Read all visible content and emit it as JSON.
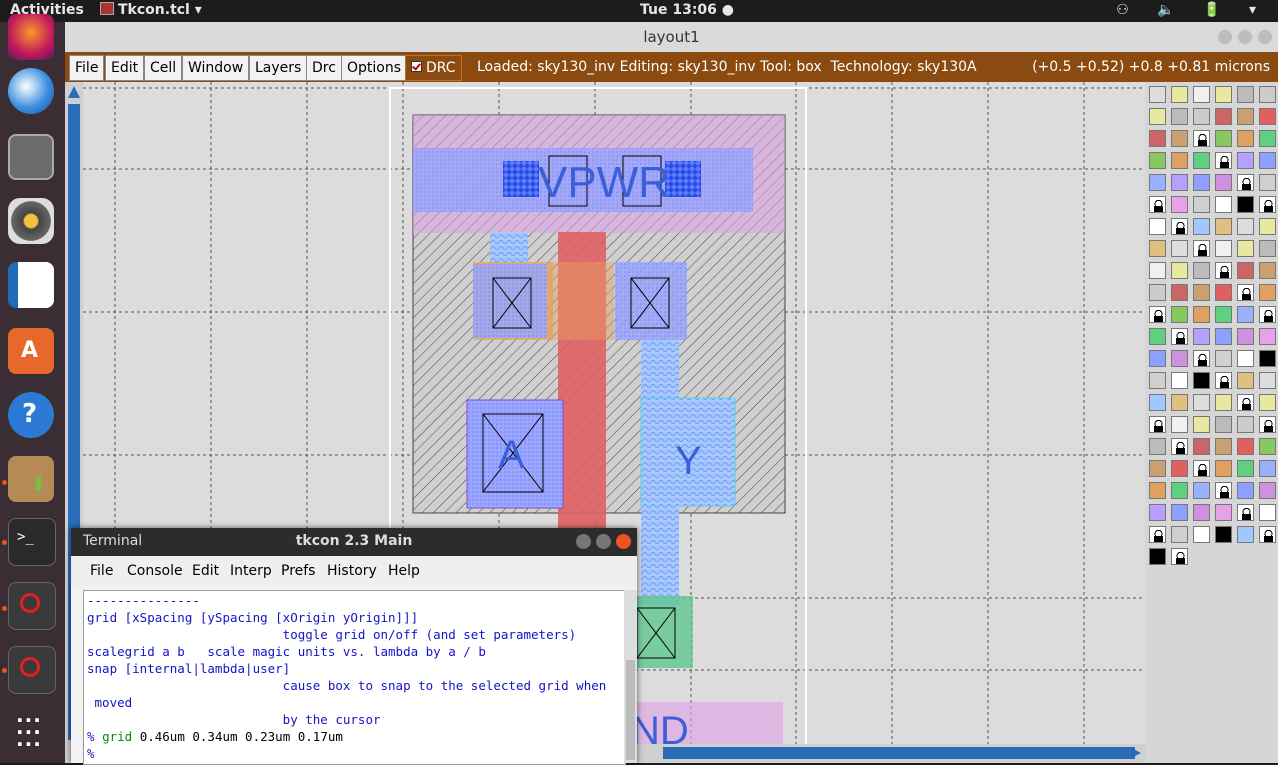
{
  "topbar": {
    "activities": "Activities",
    "app_name": "Tkcon.tcl ▾",
    "clock": "Tue 13:06 ●",
    "tray": "⚇ 🔈 🔋 ▾"
  },
  "magic": {
    "window_title": "layout1",
    "menu": [
      "File",
      "Edit",
      "Cell",
      "Window",
      "Layers",
      "Drc",
      "Options"
    ],
    "drc_label": "DRC",
    "status": "Loaded: sky130_inv Editing: sky130_inv Tool: box  Technology: sky130A",
    "coords": "(+0.5 +0.52) +0.8 +0.81 microns",
    "labels": {
      "vpwr": "VPWR",
      "a": "A",
      "y": "Y",
      "vgnd": "ND"
    }
  },
  "terminal": {
    "label": "Terminal",
    "title": "tkcon 2.3 Main",
    "menu": [
      "File",
      "Console",
      "Edit",
      "Interp",
      "Prefs",
      "History",
      "Help"
    ],
    "lines": [
      "---------------",
      "grid [xSpacing [ySpacing [xOrigin yOrigin]]]",
      "                          toggle grid on/off (and set parameters)",
      "scalegrid a b   scale magic units vs. lambda by a / b",
      "snap [internal|lambda|user]",
      "                          cause box to snap to the selected grid when",
      " moved",
      "                          by the cursor"
    ],
    "prompt": "%",
    "cmd": "grid",
    "args": "0.46um 0.34um 0.23um 0.17um",
    "prompt2": "%"
  },
  "colors": {
    "menubar": "#8b4a0f",
    "metal1": "#9aa6ff",
    "poly": "#e06060",
    "li": "#b7b1ff",
    "scroll": "#2b6cb8"
  }
}
